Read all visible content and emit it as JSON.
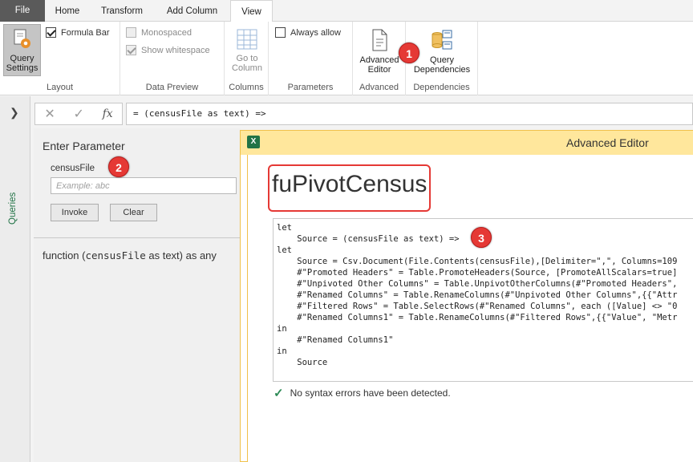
{
  "tabs": [
    "File",
    "Home",
    "Transform",
    "Add Column",
    "View"
  ],
  "ribbon": {
    "layout": {
      "query_settings_label": "Query\nSettings",
      "formula_bar_label": "Formula Bar",
      "group_label": "Layout"
    },
    "data_preview": {
      "monospaced_label": "Monospaced",
      "show_whitespace_label": "Show whitespace",
      "group_label": "Data Preview"
    },
    "columns": {
      "goto_label": "Go to\nColumn",
      "group_label": "Columns"
    },
    "parameters": {
      "always_allow_label": "Always allow",
      "group_label": "Parameters"
    },
    "advanced": {
      "editor_label": "Advanced\nEditor",
      "group_label": "Advanced"
    },
    "dependencies": {
      "query_deps_label": "Query\nDependencies",
      "group_label": "Dependencies"
    }
  },
  "markers": {
    "m1": "1",
    "m2": "2",
    "m3": "3"
  },
  "rail": {
    "label": "Queries"
  },
  "formula_bar": {
    "cancel": "✕",
    "commit": "✓",
    "fx": "fx",
    "text": "= (censusFile as text) =>"
  },
  "param_panel": {
    "title": "Enter Parameter",
    "param_name": "censusFile",
    "placeholder": "Example: abc",
    "invoke_label": "Invoke",
    "clear_label": "Clear",
    "signature_prefix": "function (",
    "signature_param": "censusFile",
    "signature_suffix": " as text) as any"
  },
  "dialog": {
    "icon": "X",
    "title": "Advanced Editor",
    "query_name": "fuPivotCensus",
    "code_lines": [
      "let",
      "    Source = (censusFile as text) =>",
      "let",
      "    Source = Csv.Document(File.Contents(censusFile),[Delimiter=\",\", Columns=109",
      "    #\"Promoted Headers\" = Table.PromoteHeaders(Source, [PromoteAllScalars=true]",
      "    #\"Unpivoted Other Columns\" = Table.UnpivotOtherColumns(#\"Promoted Headers\",",
      "    #\"Renamed Columns\" = Table.RenameColumns(#\"Unpivoted Other Columns\",{{\"Attr",
      "    #\"Filtered Rows\" = Table.SelectRows(#\"Renamed Columns\", each ([Value] <> \"0",
      "    #\"Renamed Columns1\" = Table.RenameColumns(#\"Filtered Rows\",{{\"Value\", \"Metr",
      "in",
      "    #\"Renamed Columns1\"",
      "in",
      "    Source"
    ],
    "status_icon": "✓",
    "status_text": "No syntax errors have been detected."
  }
}
